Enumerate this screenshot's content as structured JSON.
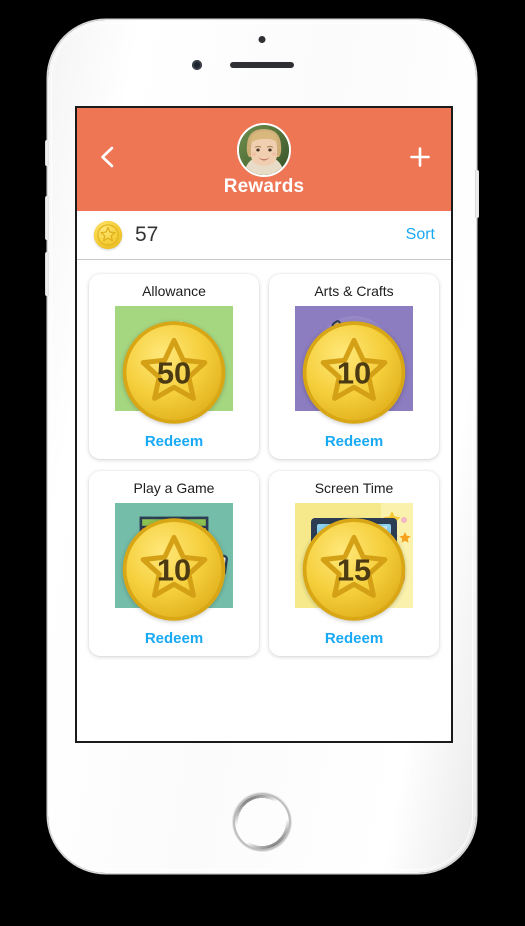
{
  "device": {
    "type": "white-smartphone",
    "home_button": "home-button",
    "speaker": "earpiece-speaker",
    "front_camera": "front-camera"
  },
  "header": {
    "title": "Rewards",
    "back_icon": "chevron-left-icon",
    "add_icon": "plus-icon",
    "avatar_alt": "user-avatar",
    "background_color": "#EE7655",
    "text_color": "#FFFFFF"
  },
  "points_bar": {
    "coin_icon": "star-coin-icon",
    "points": "57",
    "sort_label": "Sort",
    "link_color": "#18A9F5"
  },
  "rewards": [
    {
      "title": "Allowance",
      "cost": "50",
      "redeem_label": "Redeem",
      "art": "piggy-bank",
      "art_background": "#A5D680"
    },
    {
      "title": "Arts & Crafts",
      "cost": "10",
      "redeem_label": "Redeem",
      "art": "paint-palette",
      "art_background": "#8C7CC0"
    },
    {
      "title": "Play a Game",
      "cost": "10",
      "redeem_label": "Redeem",
      "art": "board-game",
      "art_background": "#74BDA8"
    },
    {
      "title": "Screen Time",
      "cost": "15",
      "redeem_label": "Redeem",
      "art": "monitor-stopwatch",
      "art_background": "#F5E98C"
    }
  ]
}
